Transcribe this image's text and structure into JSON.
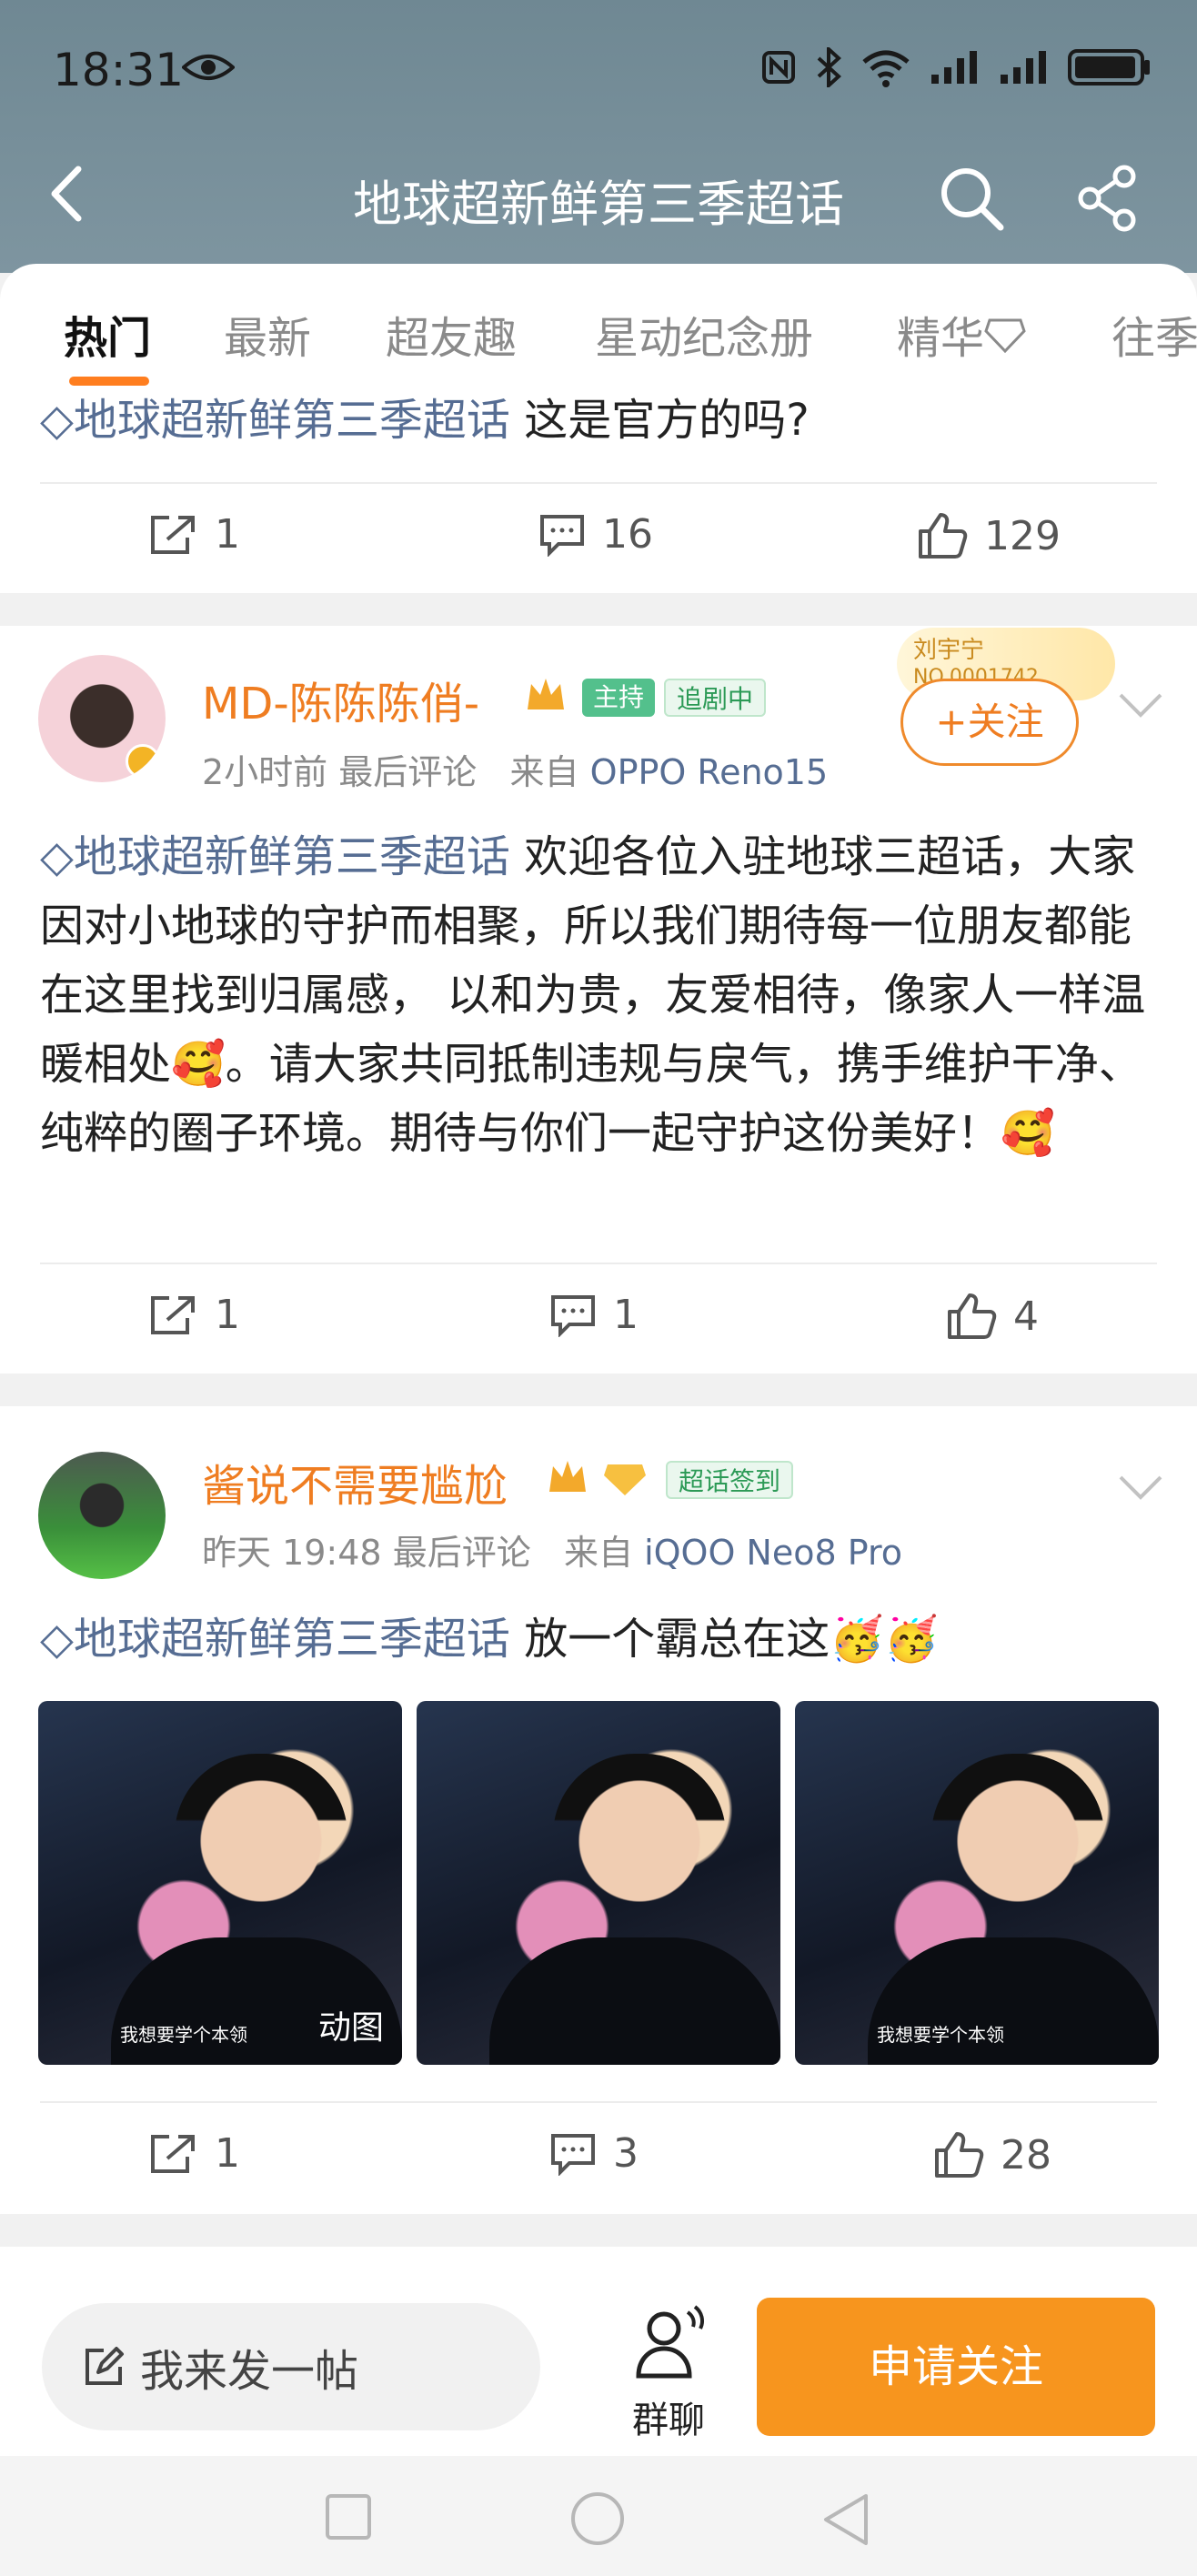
{
  "status": {
    "time": "18:31"
  },
  "navbar": {
    "title": "地球超新鲜第三季超话"
  },
  "tabs": [
    "热门",
    "最新",
    "超友趣",
    "星动纪念册",
    "精华",
    "往季"
  ],
  "posts": [
    {
      "topic": "地球超新鲜第三季超话",
      "text": "这是官方的吗?",
      "reposts": "1",
      "comments": "16",
      "likes": "129"
    },
    {
      "username": "MD-陈陈陈俏-",
      "badge_host": "主持",
      "badge_watch": "追剧中",
      "fan_tag": "刘宇宁",
      "fan_no": "NO.0001742",
      "time": "2小时前",
      "last_comment": "最后评论",
      "from": "来自",
      "device": "OPPO Reno15",
      "follow_label": "+关注",
      "topic": "地球超新鲜第三季超话",
      "text": "欢迎各位入驻地球三超话，大家因对小地球的守护而相聚，所以我们期待每一位朋友都能在这里找到归属感， 以和为贵，友爱相待，像家人一样温暖相处🥰。请大家共同抵制违规与戾气，携手维护干净、纯粹的圈子环境。期待与你们一起守护这份美好！🥰",
      "reposts": "1",
      "comments": "1",
      "likes": "4"
    },
    {
      "username": "酱说不需要尴尬",
      "badge_signin": "超话签到",
      "time": "昨天 19:48",
      "last_comment": "最后评论",
      "from": "来自",
      "device": "iQOO Neo8 Pro",
      "topic": "地球超新鲜第三季超话",
      "text": "放一个霸总在这🥳🥳",
      "image_caption": "我想要学个本领",
      "gif_label": "动图",
      "reposts": "1",
      "comments": "3",
      "likes": "28"
    }
  ],
  "bottombar": {
    "compose": "我来发一帖",
    "group": "群聊",
    "apply": "申请关注"
  },
  "colors": {
    "header": "#7e95a0",
    "accent": "#ef7d21",
    "topic": "#566d93",
    "apply_button": "#f7951e"
  }
}
